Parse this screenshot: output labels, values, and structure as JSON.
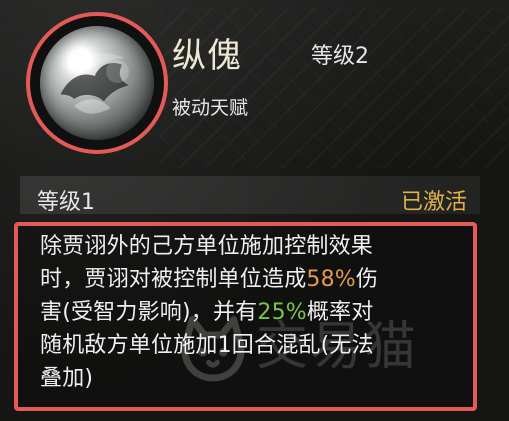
{
  "skill": {
    "name": "纵傀",
    "level_label_top": "等级2",
    "type": "被动天赋"
  },
  "status": {
    "level_label": "等级1",
    "state": "已激活"
  },
  "description": {
    "line1": "除贾诩外的己方单位施加控制效果",
    "line2_prefix": "时，贾诩对被控制单位造成",
    "line2_percent": "58%",
    "line2_suffix": "伤",
    "line3_prefix": "害(受智力影响)，并有",
    "line3_percent": "25%",
    "line3_suffix": "概率对",
    "line4": "随机敌方单位施加1回合混乱(无法",
    "line5": "叠加)"
  },
  "watermark": {
    "text": "交易猫"
  },
  "colors": {
    "highlight_border": "#e35a56",
    "activated": "#e1b24a",
    "percent_orange": "#e39a4a",
    "percent_green": "#79c44b"
  },
  "icons": {
    "skill_icon": "smoke-bird-icon",
    "watermark_logo": "cat-logo-icon"
  }
}
